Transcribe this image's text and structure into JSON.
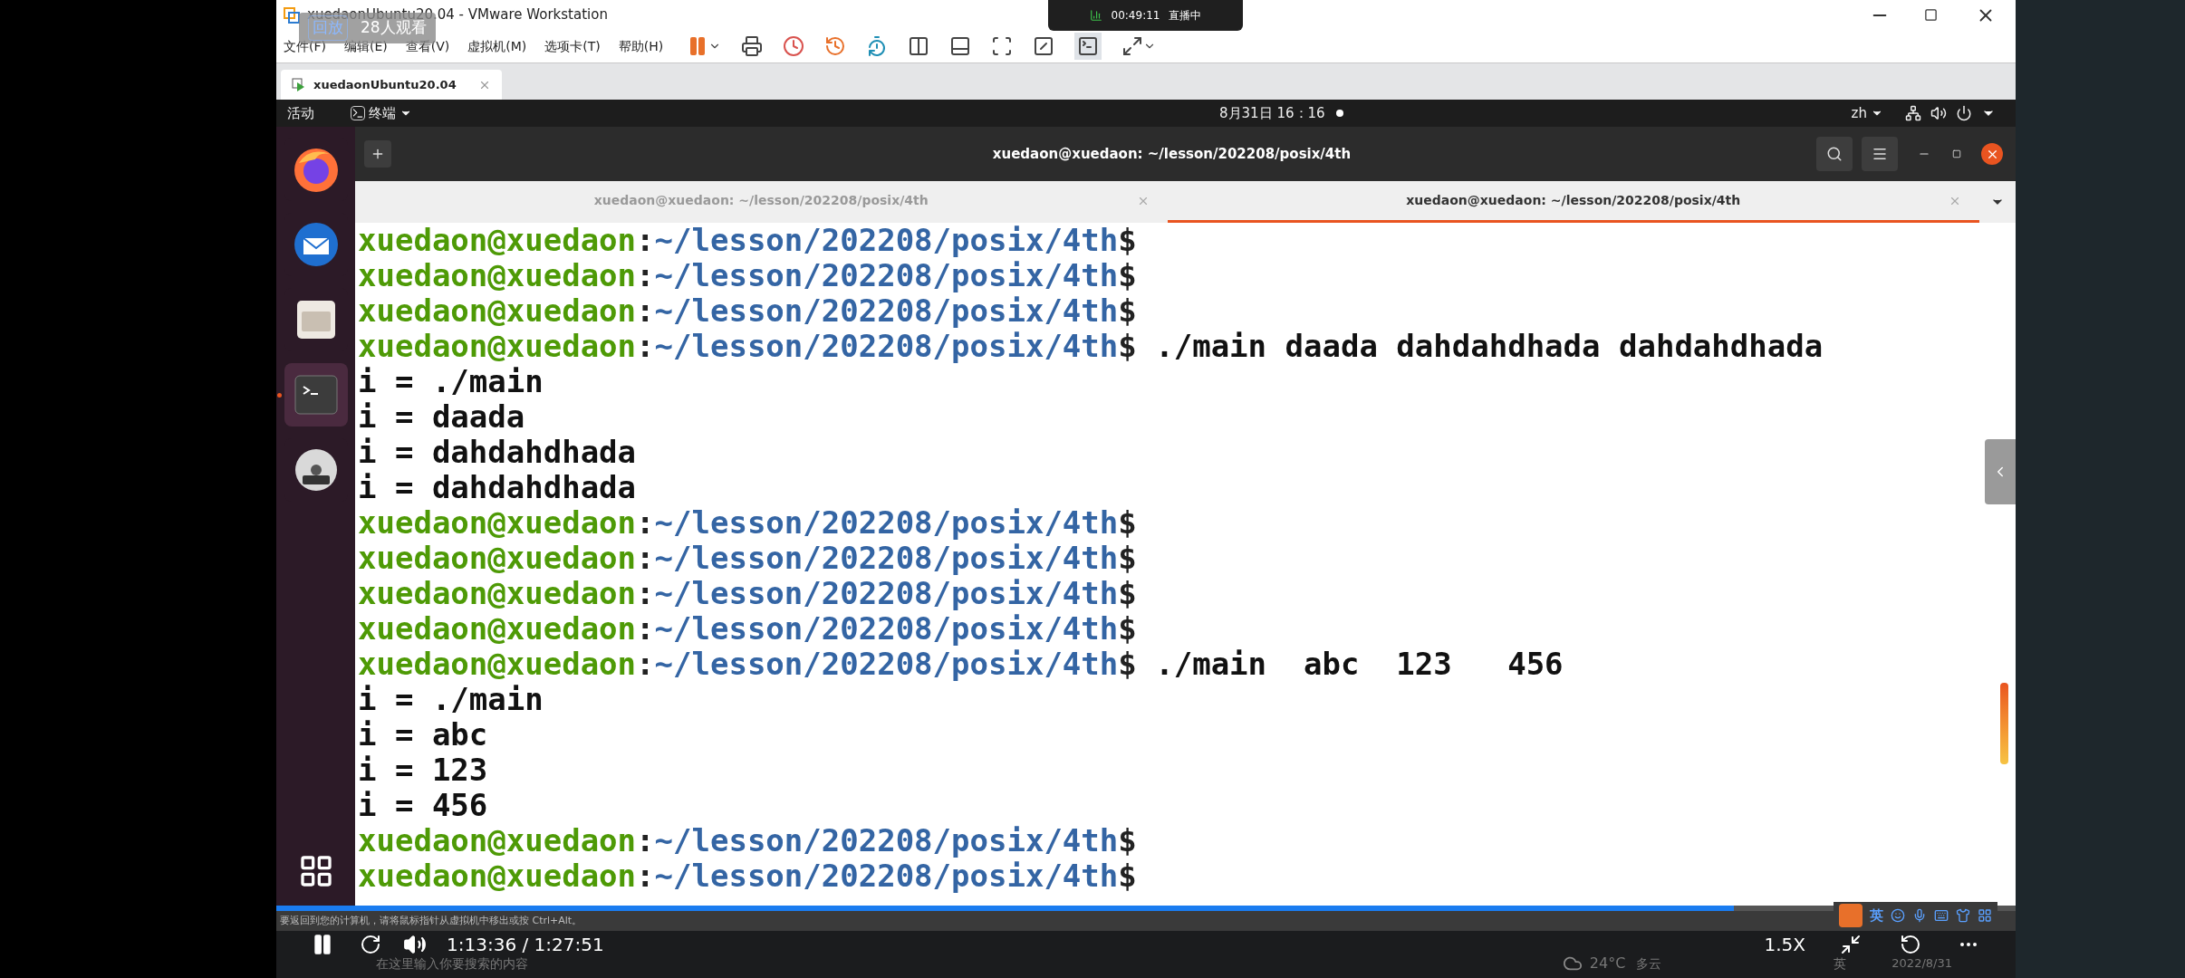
{
  "overlay": {
    "replay_label": "回放",
    "viewers": "28人观看",
    "live_time": "00:49:11",
    "live_status": "直播中"
  },
  "vmware": {
    "title": "xuedaonUbuntu20.04 - VMware Workstation",
    "menu": [
      "文件(F)",
      "编辑(E)",
      "查看(V)",
      "虚拟机(M)",
      "选项卡(T)",
      "帮助(H)"
    ],
    "tab": "xuedaonUbuntu20.04",
    "status_hint": "要返回到您的计算机，请将鼠标指针从虚拟机中移出或按 Ctrl+Alt。"
  },
  "ubuntu": {
    "activities": "活动",
    "app_menu": "终端",
    "clock": "8月31日 16：16",
    "input_method": "zh"
  },
  "dock": [
    {
      "kind": "firefox",
      "selected": false
    },
    {
      "kind": "mail",
      "selected": false
    },
    {
      "kind": "files",
      "selected": false
    },
    {
      "kind": "terminal",
      "selected": true
    },
    {
      "kind": "disc",
      "selected": false
    }
  ],
  "terminal": {
    "title": "xuedaon@xuedaon: ~/lesson/202208/posix/4th",
    "tabs": [
      {
        "label": "xuedaon@xuedaon: ~/lesson/202208/posix/4th",
        "selected": false
      },
      {
        "label": "xuedaon@xuedaon: ~/lesson/202208/posix/4th",
        "selected": true
      }
    ],
    "lines": [
      {
        "kind": "prompt",
        "user": "xuedaon@xuedaon",
        "separator": ":",
        "path": "~/lesson/202208/posix/4th",
        "symbol": "$"
      },
      {
        "kind": "prompt",
        "user": "xuedaon@xuedaon",
        "separator": ":",
        "path": "~/lesson/202208/posix/4th",
        "symbol": "$"
      },
      {
        "kind": "prompt",
        "user": "xuedaon@xuedaon",
        "separator": ":",
        "path": "~/lesson/202208/posix/4th",
        "symbol": "$"
      },
      {
        "kind": "prompt",
        "user": "xuedaon@xuedaon",
        "separator": ":",
        "path": "~/lesson/202208/posix/4th",
        "symbol": "$",
        "command": "./main daada dahdahdhada dahdahdhada"
      },
      {
        "kind": "output",
        "text": "i = ./main"
      },
      {
        "kind": "output",
        "text": "i = daada"
      },
      {
        "kind": "output",
        "text": "i = dahdahdhada"
      },
      {
        "kind": "output",
        "text": "i = dahdahdhada"
      },
      {
        "kind": "prompt",
        "user": "xuedaon@xuedaon",
        "separator": ":",
        "path": "~/lesson/202208/posix/4th",
        "symbol": "$"
      },
      {
        "kind": "prompt",
        "user": "xuedaon@xuedaon",
        "separator": ":",
        "path": "~/lesson/202208/posix/4th",
        "symbol": "$"
      },
      {
        "kind": "prompt",
        "user": "xuedaon@xuedaon",
        "separator": ":",
        "path": "~/lesson/202208/posix/4th",
        "symbol": "$"
      },
      {
        "kind": "prompt",
        "user": "xuedaon@xuedaon",
        "separator": ":",
        "path": "~/lesson/202208/posix/4th",
        "symbol": "$"
      },
      {
        "kind": "prompt",
        "user": "xuedaon@xuedaon",
        "separator": ":",
        "path": "~/lesson/202208/posix/4th",
        "symbol": "$",
        "command": "./main  abc  123   456"
      },
      {
        "kind": "output",
        "text": "i = ./main"
      },
      {
        "kind": "output",
        "text": "i = abc"
      },
      {
        "kind": "output",
        "text": "i = 123"
      },
      {
        "kind": "output",
        "text": "i = 456"
      },
      {
        "kind": "prompt",
        "user": "xuedaon@xuedaon",
        "separator": ":",
        "path": "~/lesson/202208/posix/4th",
        "symbol": "$"
      },
      {
        "kind": "prompt",
        "user": "xuedaon@xuedaon",
        "separator": ":",
        "path": "~/lesson/202208/posix/4th",
        "symbol": "$"
      }
    ]
  },
  "taskbar": {
    "search_placeholder": "在这里输入你要搜索的内容",
    "temperature": "24°C",
    "weather": "多云",
    "ime": "英",
    "date": "2022/8/31"
  },
  "ime_bar": {
    "label": "英"
  },
  "player": {
    "level": 0.838,
    "time": "1:13:36 / 1:27:51",
    "speed": "1.5X"
  }
}
